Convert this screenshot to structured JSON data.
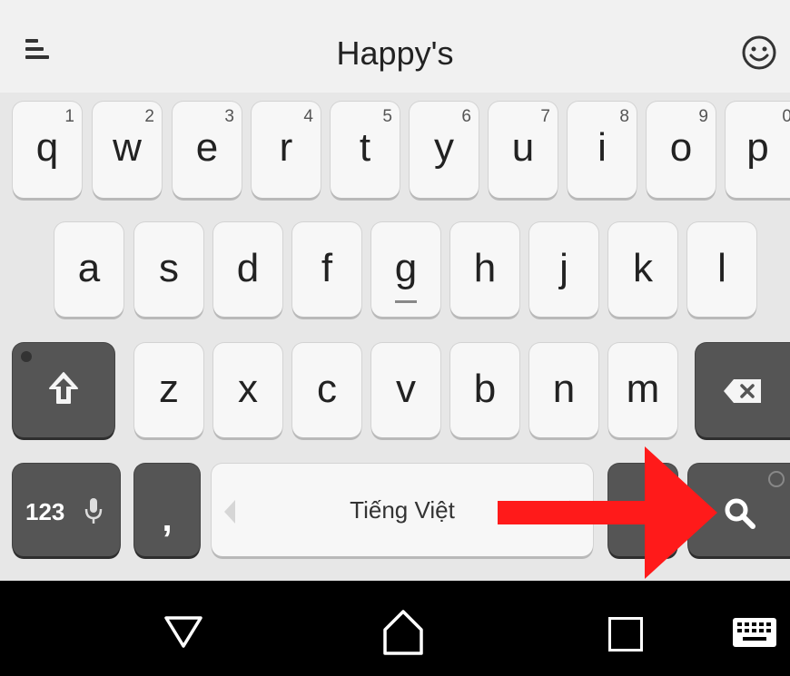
{
  "topbar": {
    "suggestion": "Happy's",
    "menu_icon": "menu-icon",
    "emoji_icon": "emoji-icon"
  },
  "keyboard": {
    "row1": [
      {
        "label": "q",
        "num": "1"
      },
      {
        "label": "w",
        "num": "2"
      },
      {
        "label": "e",
        "num": "3"
      },
      {
        "label": "r",
        "num": "4"
      },
      {
        "label": "t",
        "num": "5"
      },
      {
        "label": "y",
        "num": "6"
      },
      {
        "label": "u",
        "num": "7"
      },
      {
        "label": "i",
        "num": "8"
      },
      {
        "label": "o",
        "num": "9"
      },
      {
        "label": "p",
        "num": "0"
      }
    ],
    "row2": [
      "a",
      "s",
      "d",
      "f",
      "g",
      "h",
      "j",
      "k",
      "l"
    ],
    "row3": [
      "z",
      "x",
      "c",
      "v",
      "b",
      "n",
      "m"
    ],
    "shift_icon": "shift-icon",
    "backspace_icon": "backspace-icon",
    "symbols_label": "123",
    "mic_icon": "mic-icon",
    "comma_label": ",",
    "space_label": "Tiếng Việt",
    "search_icon": "search-icon"
  },
  "navbar": {
    "back_icon": "back-triangle-icon",
    "home_icon": "home-icon",
    "recents_icon": "recents-square-icon",
    "keyboard_icon": "keyboard-icon"
  },
  "annotation": {
    "arrow_color": "#ff1a1a",
    "target": "search-key"
  }
}
